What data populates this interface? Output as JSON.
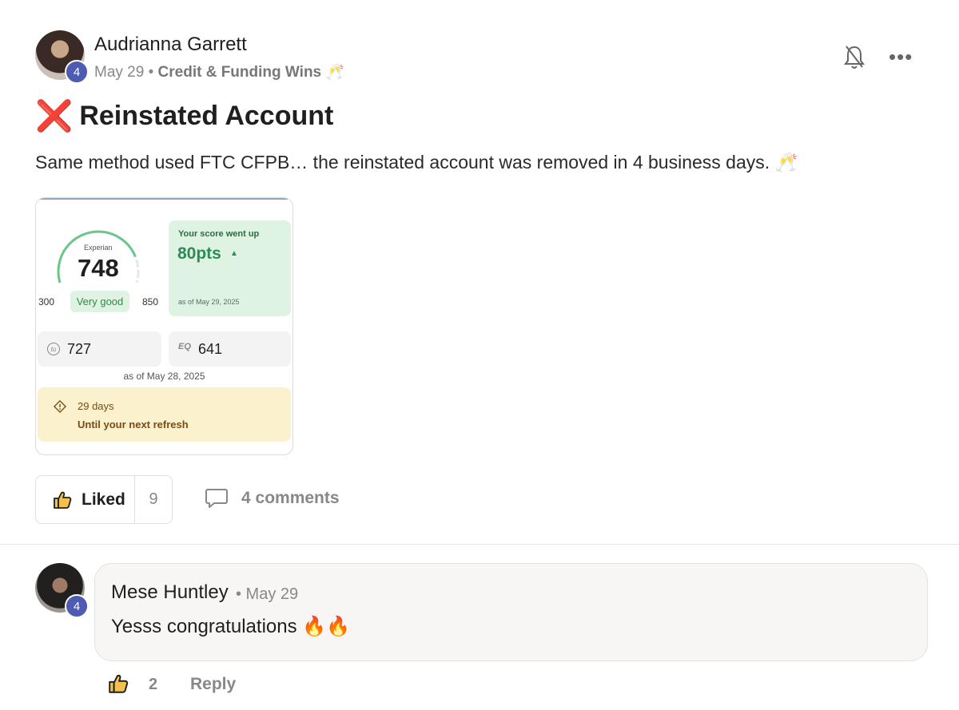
{
  "post": {
    "author": "Audrianna Garrett",
    "level": "4",
    "date": "May 29",
    "separator": "•",
    "category": "Credit & Funding Wins 🥂",
    "title_emoji": "❌",
    "title": "Reinstated Account",
    "body": "Same method used FTC CFPB… the reinstated account was removed in 4 business days. 🥂"
  },
  "score_card": {
    "bureau": "Experian",
    "score": "748",
    "range_min": "300",
    "range_max": "850",
    "rating": "Very good",
    "change_title": "Your score went up",
    "change_value": "80pts",
    "change_arrow": "▲",
    "change_date": "as of May 29, 2025",
    "tu_icon": "tu",
    "tu_score": "727",
    "eq_icon": "EQ",
    "eq_score": "641",
    "other_date": "as of May 28, 2025",
    "refresh_days": "29 days",
    "refresh_text": "Until your next refresh",
    "gauge_fraction": 0.82
  },
  "actions": {
    "liked_label": "Liked",
    "like_count": "9",
    "comments_label": "4 comments"
  },
  "comment": {
    "author": "Mese Huntley",
    "level": "4",
    "date": "• May 29",
    "text": "Yesss congratulations 🔥🔥",
    "likes": "2",
    "reply_label": "Reply"
  },
  "icons": {
    "bell": "bell-off-icon",
    "more": "more-icon",
    "like": "thumbs-up-icon",
    "comment": "comment-icon",
    "warning": "warning-icon"
  },
  "colors": {
    "level_badge": "#4d5bb3",
    "score_green": "#2f8a57",
    "refresh_bg": "#fbf1cc"
  }
}
